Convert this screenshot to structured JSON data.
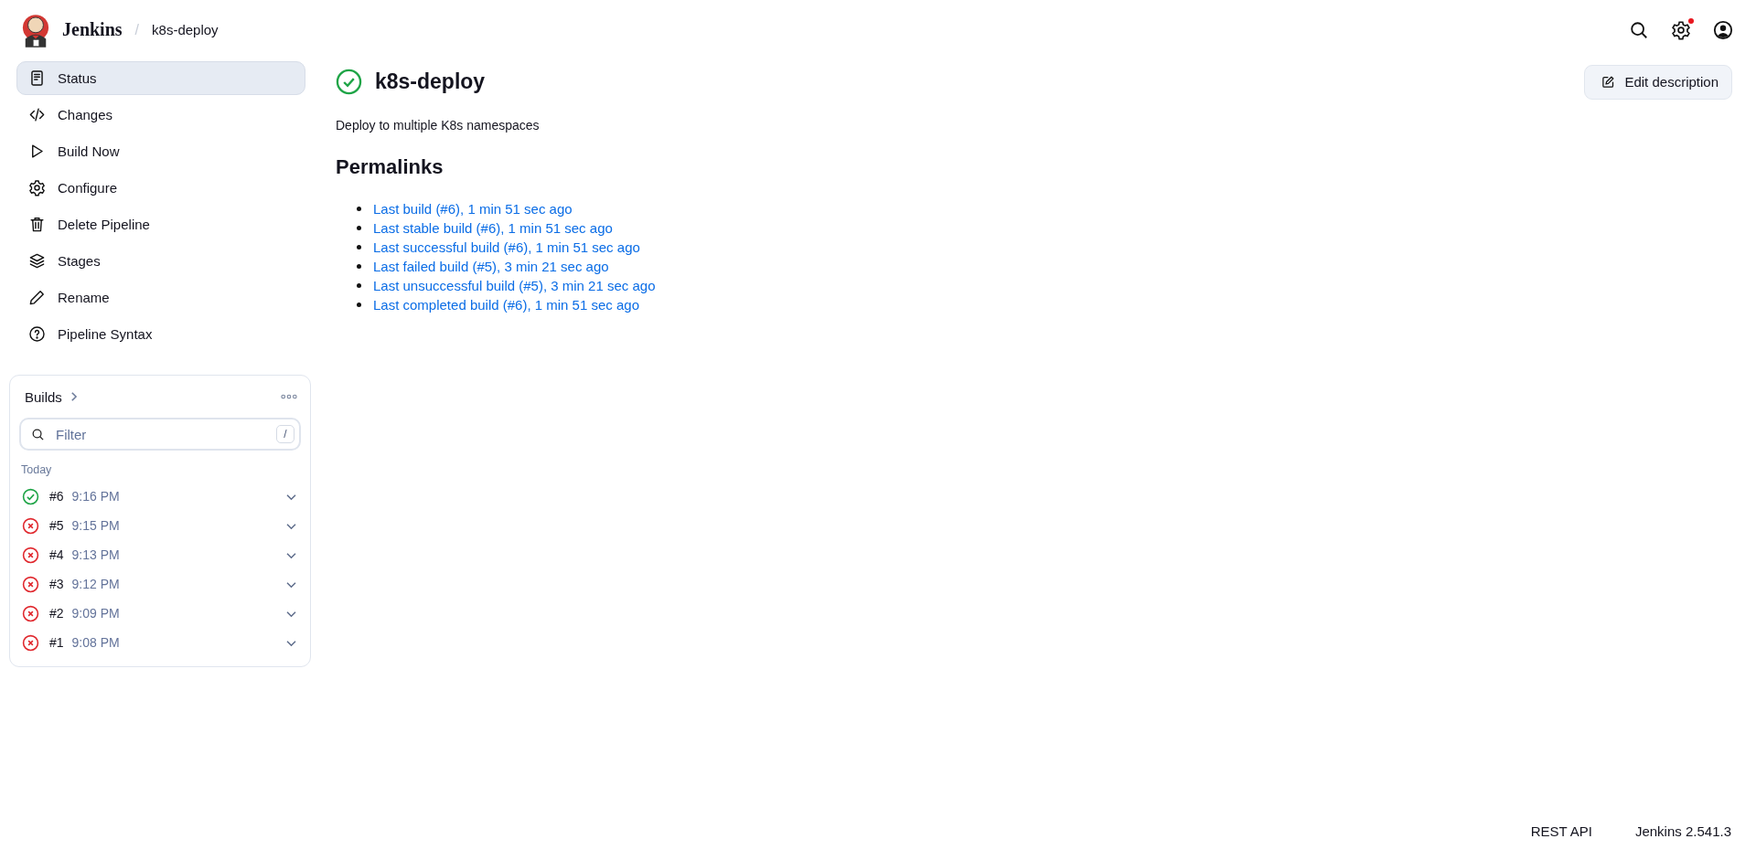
{
  "header": {
    "brand": "Jenkins",
    "separator": "/",
    "breadcrumb": "k8s-deploy",
    "settings_notification": true
  },
  "sidebar": {
    "items": [
      {
        "label": "Status",
        "selected": true
      },
      {
        "label": "Changes",
        "selected": false
      },
      {
        "label": "Build Now",
        "selected": false
      },
      {
        "label": "Configure",
        "selected": false
      },
      {
        "label": "Delete Pipeline",
        "selected": false
      },
      {
        "label": "Stages",
        "selected": false
      },
      {
        "label": "Rename",
        "selected": false
      },
      {
        "label": "Pipeline Syntax",
        "selected": false
      }
    ]
  },
  "builds": {
    "title": "Builds",
    "filter": {
      "placeholder": "Filter",
      "shortcut": "/"
    },
    "group": "Today",
    "rows": [
      {
        "number": "#6",
        "time": "9:16 PM",
        "success": true
      },
      {
        "number": "#5",
        "time": "9:15 PM",
        "success": false
      },
      {
        "number": "#4",
        "time": "9:13 PM",
        "success": false
      },
      {
        "number": "#3",
        "time": "9:12 PM",
        "success": false
      },
      {
        "number": "#2",
        "time": "9:09 PM",
        "success": false
      },
      {
        "number": "#1",
        "time": "9:08 PM",
        "success": false
      }
    ]
  },
  "main": {
    "title": "k8s-deploy",
    "success": true,
    "edit_button": "Edit description",
    "description": "Deploy to multiple K8s namespaces",
    "permalinks_heading": "Permalinks",
    "permalinks": [
      "Last build (#6), 1 min 51 sec ago",
      "Last stable build (#6), 1 min 51 sec ago",
      "Last successful build (#6), 1 min 51 sec ago",
      "Last failed build (#5), 3 min 21 sec ago",
      "Last unsuccessful build (#5), 3 min 21 sec ago",
      "Last completed build (#6), 1 min 51 sec ago"
    ]
  },
  "footer": {
    "links": [
      "REST API",
      "Jenkins 2.541.3"
    ]
  }
}
